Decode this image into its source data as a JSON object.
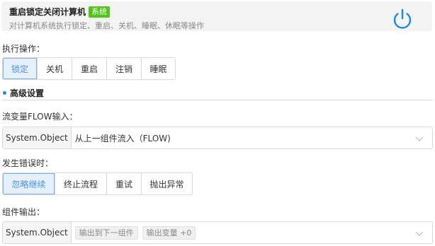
{
  "header": {
    "title": "重启锁定关闭计算机",
    "badge": "系统",
    "description": "对计算机系统执行锁定、重启、关机、睡眠、休眠等操作",
    "power_icon": "power-icon"
  },
  "operation": {
    "label": "执行操作：",
    "options": [
      "锁定",
      "关机",
      "重启",
      "注销",
      "睡眠"
    ],
    "selected": "锁定"
  },
  "advanced": {
    "title": "高级设置"
  },
  "flow_input": {
    "label": "流变量FLOW输入：",
    "prefix": "System.Object",
    "value": "从上一组件流入（FLOW)"
  },
  "on_error": {
    "label": "发生错误时：",
    "options": [
      "忽略继续",
      "终止流程",
      "重试",
      "抛出异常"
    ],
    "selected": "忽略继续"
  },
  "output": {
    "label": "组件输出：",
    "prefix": "System.Object",
    "tags": [
      "输出到下一组件",
      "输出变量 +0"
    ]
  },
  "colors": {
    "accent": "#1e88e5",
    "badge": "#52c41a",
    "active_bg": "#e6f0fb"
  }
}
